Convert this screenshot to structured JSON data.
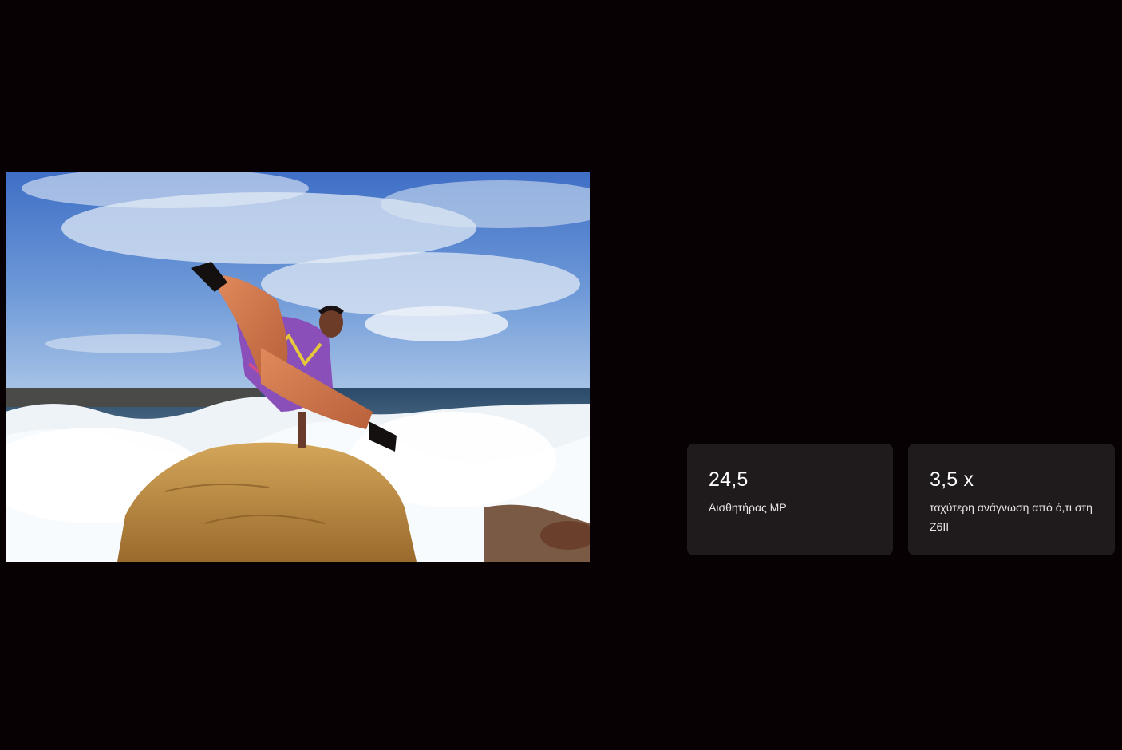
{
  "hero_image": {
    "subject": "dancer-on-rock-at-sea-icon"
  },
  "stats": [
    {
      "value": "24,5",
      "label": "Αισθητήρας MP"
    },
    {
      "value": "3,5 x",
      "label": "ταχύτερη ανάγνωση από ό,τι στη Z6II"
    }
  ],
  "colors": {
    "background": "#070104",
    "card": "#1f1a1b",
    "text": "#ffffff"
  }
}
